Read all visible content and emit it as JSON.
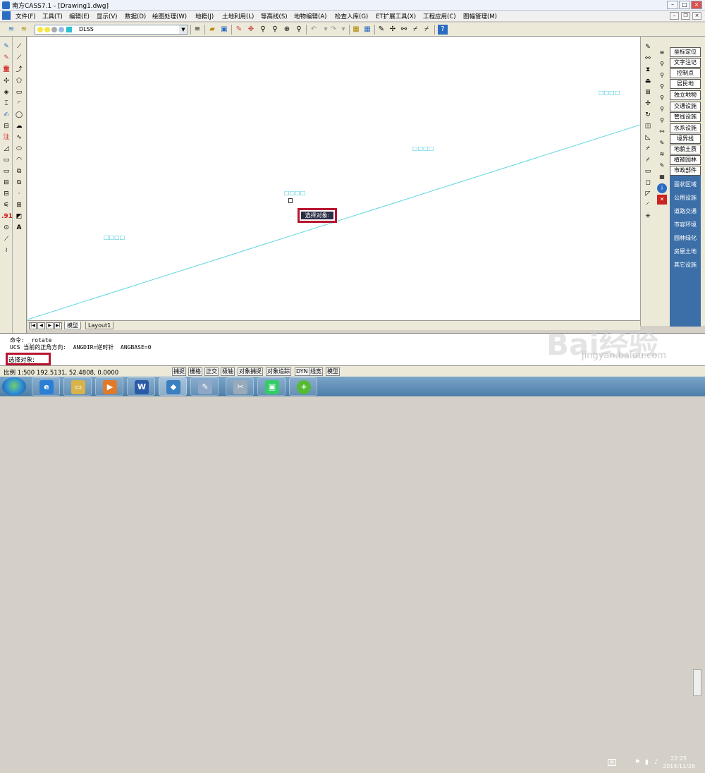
{
  "window": {
    "title": "南方CASS7.1 - [Drawing1.dwg]"
  },
  "menu": [
    "文件(F)",
    "工具(T)",
    "编辑(E)",
    "显示(V)",
    "数据(D)",
    "绘图处理(W)",
    "地籍(J)",
    "土地利用(L)",
    "等高线(S)",
    "地物编辑(A)",
    "检查入库(G)",
    "ET扩展工具(X)",
    "工程应用(C)",
    "图幅管理(M)"
  ],
  "toolbar": {
    "layer_name": "DLSS"
  },
  "canvas": {
    "labels": [
      "□□□□",
      "□□□□",
      "□□□□",
      "□□□□"
    ],
    "tooltip": "选择对象:"
  },
  "tabs": {
    "model": "模型",
    "layout": "Layout1"
  },
  "category_buttons": [
    "坐标定位",
    "文字注记",
    "控制点",
    "居民地",
    "独立地物",
    "交通设施",
    "管线设施",
    "水系设施",
    "境界线",
    "地貌土质",
    "植被园林",
    "市政部件"
  ],
  "sub_items": [
    "面状区域",
    "公用设施",
    "道路交通",
    "市容环境",
    "园林绿化",
    "房屋土地",
    "其它设施"
  ],
  "command": {
    "line1": "命令: _rotate",
    "line2": "UCS 当前的正角方向:  ANGDIR=逆时针  ANGBASE=0",
    "prompt": "选择对象:"
  },
  "status": {
    "coords": "比例 1:500  192.5131, 52.4808, 0.0000",
    "toggles": [
      "捕捉",
      "栅格",
      "正交",
      "极轴",
      "对象捕捉",
      "对象追踪",
      "DYN",
      "线宽",
      "模型"
    ]
  },
  "clock": {
    "time": "22:25",
    "date": "2014/11/26"
  },
  "watermark": {
    "brand": "Bai经验",
    "url": "jingyan.baidu.com"
  },
  "colors": {
    "line": "#5cd6e0",
    "label": "#2cc2d6",
    "highlight": "#b8152f",
    "panel": "#3c6fa8"
  }
}
